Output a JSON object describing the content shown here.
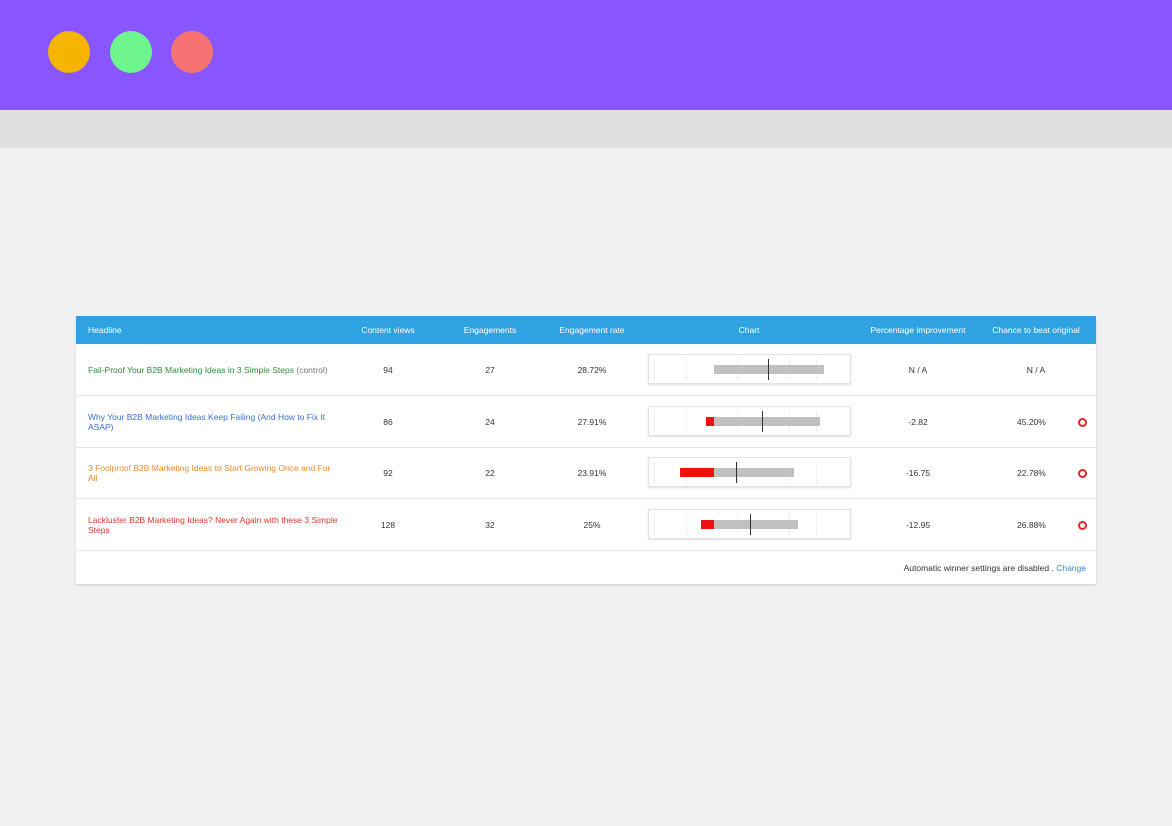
{
  "window": {
    "controls": [
      "minimize-dot",
      "maximize-dot",
      "close-dot"
    ],
    "colors": {
      "titlebar": "#8855ff",
      "dot1": "#f5b400",
      "dot2": "#6ff58e",
      "dot3": "#f77373"
    }
  },
  "table": {
    "header_color": "#2fa3e2",
    "columns": {
      "headline": "Headline",
      "views": "Content views",
      "engagements": "Engagements",
      "rate": "Engagement rate",
      "chart": "Chart",
      "improvement": "Percentage improvement",
      "chance": "Chance to beat original"
    },
    "rows": [
      {
        "headline": "Fail-Proof Your B2B Marketing Ideas in 3 Simple Steps",
        "tag": "(control)",
        "color": "#2e8b3c",
        "views": "94",
        "engagements": "27",
        "rate": "28.72%",
        "improvement": "N / A",
        "chance": "N / A",
        "status_icon": null
      },
      {
        "headline": "Why Your B2B Marketing Ideas Keep Failing (And How to Fix It ASAP)",
        "color": "#3a6fd8",
        "views": "86",
        "engagements": "24",
        "rate": "27.91%",
        "improvement": "-2.82",
        "chance": "45.20%",
        "status_icon": "red-circle-icon"
      },
      {
        "headline": "3 Foolproof B2B Marketing Ideas to Start Growing Once and For All",
        "color": "#f0892a",
        "views": "92",
        "engagements": "22",
        "rate": "23.91%",
        "improvement": "-16.75",
        "chance": "22.78%",
        "status_icon": "red-circle-icon"
      },
      {
        "headline": "Lackluster B2B Marketing Ideas? Never Again with these 3 Simple Steps",
        "color": "#e03a2a",
        "views": "128",
        "engagements": "32",
        "rate": "25%",
        "improvement": "-12.95",
        "chance": "26.88%",
        "status_icon": "red-circle-icon"
      }
    ]
  },
  "footer": {
    "text": "Automatic winner settings are disabled .",
    "link": "Change"
  }
}
